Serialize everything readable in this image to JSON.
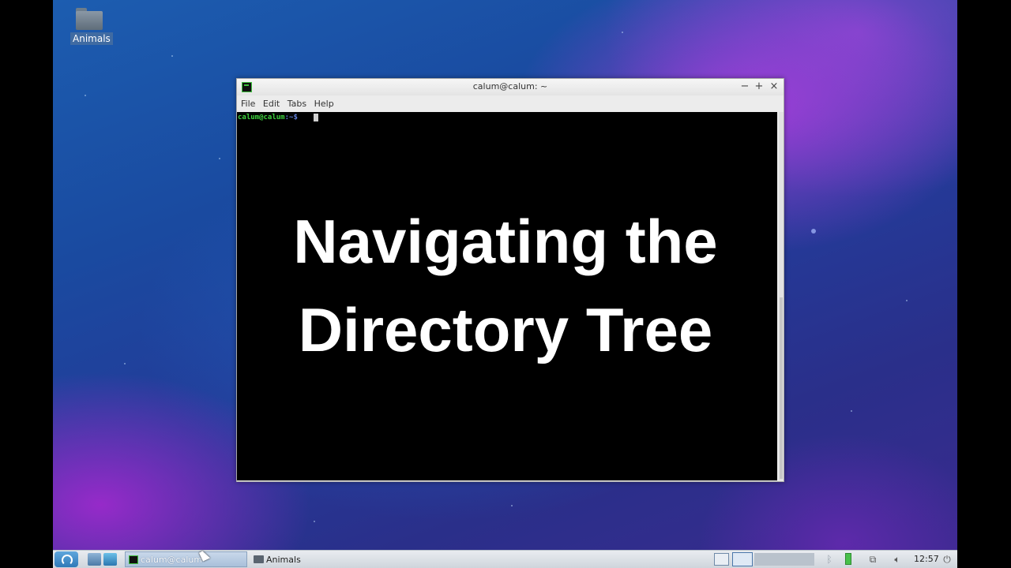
{
  "desktop": {
    "icons": [
      {
        "label": "Animals",
        "icon": "folder-icon"
      }
    ]
  },
  "terminal": {
    "title": "calum@calum: ~",
    "menu": [
      "File",
      "Edit",
      "Tabs",
      "Help"
    ],
    "prompt_user": "calum@calum",
    "prompt_path": ":~$",
    "prompt_color": "#3fd33f"
  },
  "overlay": {
    "line1": "Navigating the",
    "line2": "Directory Tree"
  },
  "taskbar": {
    "tasks": [
      {
        "label": "calum@calum",
        "icon": "terminal-icon",
        "active": true
      },
      {
        "label": "Animals",
        "icon": "folder-icon",
        "active": false
      }
    ],
    "clock": "12:57"
  },
  "colors": {
    "terminal_background": "#000000",
    "overlay_text": "#ffffff",
    "taskbar": "#dde2e8"
  }
}
